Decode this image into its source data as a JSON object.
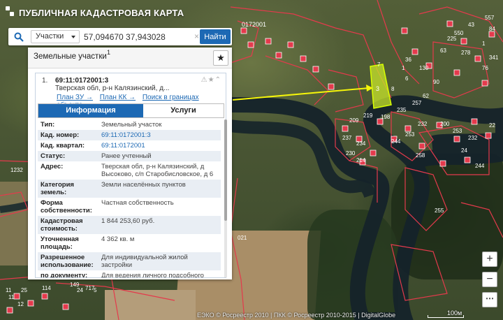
{
  "header": {
    "title": "ПУБЛИЧНАЯ КАДАСТРОВАЯ КАРТА"
  },
  "search": {
    "type_label": "Участки",
    "query": "57,094670 37,943028",
    "find_label": "Найти"
  },
  "panel": {
    "title": "Земельные участки",
    "count": "1",
    "item": {
      "number": "1.",
      "cad_number": "69:11:0172001:3",
      "address": "Тверская обл, р-н Калязинский, д...",
      "links": [
        "План ЗУ →",
        "План КК →",
        "Поиск в границах объекта →"
      ]
    },
    "tabs": {
      "info": "Информация",
      "services": "Услуги"
    },
    "rows": [
      {
        "key": "Тип:",
        "value": "Земельный участок",
        "link": false
      },
      {
        "key": "Кад. номер:",
        "value": "69:11:0172001:3",
        "link": true
      },
      {
        "key": "Кад. квартал:",
        "value": "69:11:0172001",
        "link": true
      },
      {
        "key": "Статус:",
        "value": "Ранее учтенный",
        "link": false
      },
      {
        "key": "Адрес:",
        "value": "Тверская обл, р-н Калязинский, д Высоково, с/п Старобисловское, д 6",
        "link": false
      },
      {
        "key": "Категория земель:",
        "value": "Земли населённых пунктов",
        "link": false
      },
      {
        "key": "Форма собственности:",
        "value": "Частная собственность",
        "link": false
      },
      {
        "key": "Кадастровая стоимость:",
        "value": "1 844 253,60 руб.",
        "link": false
      },
      {
        "key": "Уточненная площадь:",
        "value": "4 362 кв. м",
        "link": false
      },
      {
        "key": "Разрешенное использование:",
        "value": "Для индивидуальной жилой застройки",
        "link": false
      },
      {
        "key": "по документу:",
        "value": "Для ведения личного подсобного хозяйства",
        "link": false
      }
    ]
  },
  "map": {
    "quarter_label": "0172001",
    "selected_plot_label": "3",
    "plot_labels": [
      "43",
      "557",
      "84",
      "550",
      "63",
      "1",
      "225",
      "278",
      "130",
      "90",
      "62",
      "76",
      "341",
      "1",
      "7",
      "36",
      "6",
      "8",
      "209",
      "219",
      "237",
      "234",
      "230",
      "214",
      "198",
      "235",
      "257",
      "244",
      "253",
      "232",
      "200",
      "253",
      "232",
      "24",
      "258",
      "244",
      "255",
      "1232",
      "11",
      "114",
      "149",
      "25",
      "24",
      "717",
      "5",
      "11",
      "12",
      "021",
      "22"
    ],
    "attribution": "ЕЭКО © Росреестр 2010 | ПКК © Росреестр 2010-2015 | DigitalGlobe",
    "scale": "100м"
  },
  "colors": {
    "accent": "#1d69b4",
    "selected_plot": "#c8e62a",
    "boundary": "#e43a4c",
    "arrow": "#f5f50a"
  }
}
